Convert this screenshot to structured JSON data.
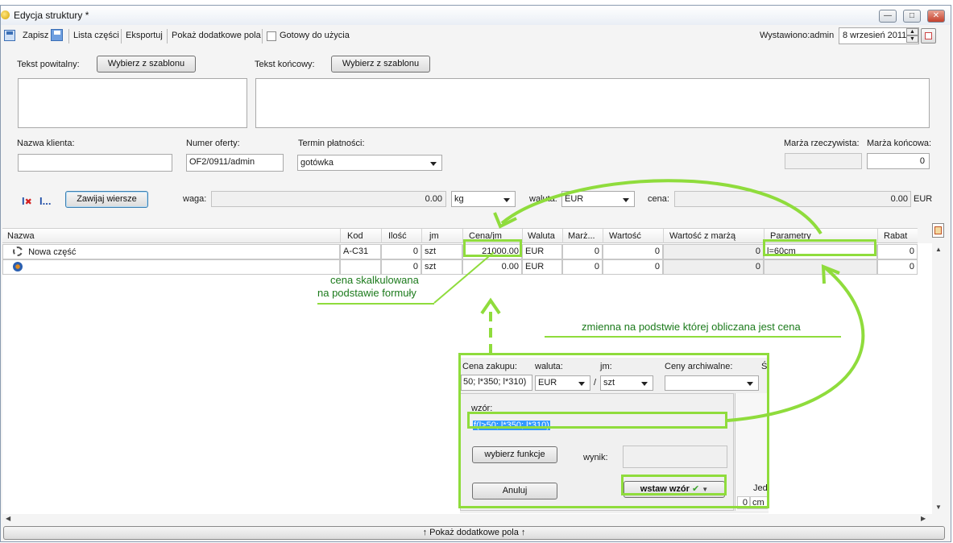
{
  "window": {
    "title": "Edycja struktury  *"
  },
  "toolbar": {
    "save_label": "Zapisz",
    "parts_list_label": "Lista części",
    "export_label": "Eksportuj",
    "show_fields_label": "Pokaż dodatkowe pola",
    "ready_label": "Gotowy do użycia",
    "issued_label": "Wystawiono:admin",
    "date_value": "8 wrzesień 2011"
  },
  "intro": {
    "intro_label": "Tekst powitalny:",
    "intro_template_button": "Wybierz z szablonu",
    "end_label": "Tekst końcowy:",
    "end_template_button": "Wybierz z szablonu",
    "intro_text": "",
    "end_text": ""
  },
  "client": {
    "client_name_label": "Nazwa klienta:",
    "client_name_value": "",
    "offer_number_label": "Numer oferty:",
    "offer_number_value": "OF2/0911/admin",
    "payment_term_label": "Termin płatności:",
    "payment_term_value": "gotówka",
    "real_margin_label": "Marża rzeczywista:",
    "real_margin_value": "",
    "final_margin_label": "Marża końcowa:",
    "final_margin_value": "0"
  },
  "summary": {
    "wrap_rows_button": "Zawijaj wiersze",
    "weight_label": "waga:",
    "weight_value": "0.00",
    "weight_unit": "kg",
    "currency_label": "waluta:",
    "currency_value": "EUR",
    "price_label": "cena:",
    "price_value": "0.00",
    "price_currency": "EUR"
  },
  "grid": {
    "columns": [
      "Nazwa",
      "Kod",
      "Ilość",
      "jm",
      "Cena/jm",
      "Waluta",
      "Marż...",
      "Wartość",
      "Wartość z marżą",
      "Parametry",
      "Rabat"
    ],
    "rows": [
      {
        "name": "Nowa część",
        "code": "A-C31",
        "qty": "0",
        "unit": "szt",
        "price": "21000.00",
        "currency": "EUR",
        "margin": "0",
        "value": "0",
        "value_margin": "0",
        "params": "l=60cm",
        "discount": "0"
      },
      {
        "name": "",
        "code": "",
        "qty": "0",
        "unit": "szt",
        "price": "0.00",
        "currency": "EUR",
        "margin": "0",
        "value": "0",
        "value_margin": "0",
        "params": "",
        "discount": "0"
      }
    ]
  },
  "popup": {
    "purchase_price_label": "Cena zakupu:",
    "purchase_price_value": "50; l*350; l*310)",
    "currency_label": "waluta:",
    "currency_value": "EUR",
    "slash": "/",
    "unit_label": "jm:",
    "unit_value": "szt",
    "archive_label": "Ceny archiwalne:",
    "archive_value": "",
    "extra_header": "Ś",
    "formula_label": "wzór:",
    "formula_value": "f(l>50; l*350; l*310)",
    "choose_function_button": "wybierz funkcje",
    "result_label": "wynik:",
    "result_value": "",
    "cancel_button": "Anuluj",
    "insert_formula_button": "wstaw wzór",
    "side_col_header": "Jed",
    "side_cell_value": "0",
    "side_cell_unit": "cm"
  },
  "annotations": {
    "calculated_price": "cena skalkulowana",
    "calculated_price_2": "na podstawie formuły",
    "variable_note": "zmienna na podstwie której obliczana jest cena"
  },
  "footer": {
    "show_fields_label": "↑ Pokaż dodatkowe pola ↑"
  },
  "colors": {
    "annotation_green": "#8fdc3c",
    "selection_blue": "#3399ff",
    "window_border": "#8a9bb0"
  }
}
